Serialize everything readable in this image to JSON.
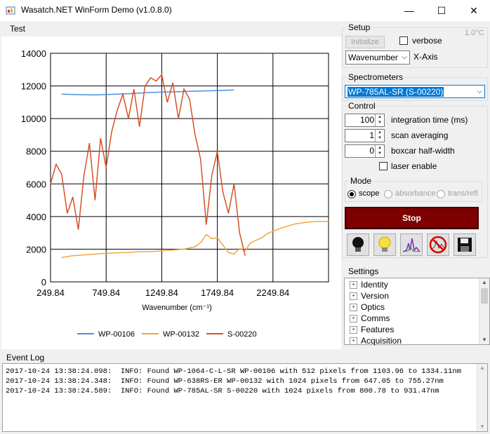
{
  "window": {
    "title": "Wasatch.NET WinForm Demo (v1.0.8.0)",
    "minimize": "—",
    "maximize": "☐",
    "close": "✕"
  },
  "tabs": [
    {
      "label": "Test"
    }
  ],
  "setup": {
    "title": "Setup",
    "initialize_label": "Initialize",
    "verbose_label": "verbose",
    "temperature": "1.0°C",
    "x_axis_value": "Wavenumber",
    "x_axis_label": "X-Axis"
  },
  "spectrometers": {
    "title": "Spectrometers",
    "selected": "WP-785AL-SR (S-00220)"
  },
  "control": {
    "title": "Control",
    "integration_time": {
      "value": "100",
      "label": "integration time (ms)"
    },
    "scan_averaging": {
      "value": "1",
      "label": "scan averaging"
    },
    "boxcar": {
      "value": "0",
      "label": "boxcar half-width"
    },
    "laser_label": "laser enable",
    "mode": {
      "title": "Mode",
      "options": [
        "scope",
        "absorbance",
        "trans/refl"
      ],
      "selected": "scope"
    },
    "stop_label": "Stop"
  },
  "settings": {
    "title": "Settings",
    "items": [
      "Identity",
      "Version",
      "Optics",
      "Comms",
      "Features",
      "Acquisition"
    ]
  },
  "event_log": {
    "title": "Event Log",
    "lines": [
      "2017-10-24 13:38:24.098:  INFO: Found WP-1064-C-L-SR WP-00106 with 512 pixels from 1103.96 to 1334.11nm",
      "2017-10-24 13:38:24.348:  INFO: Found WP-638RS-ER WP-00132 with 1024 pixels from 647.05 to 755.27nm",
      "2017-10-24 13:38:24.589:  INFO: Found WP-785AL-SR S-00220 with 1024 pixels from 800.78 to 931.47nm"
    ]
  },
  "chart_data": {
    "type": "line",
    "xlabel": "Wavenumber (cm⁻¹)",
    "ylabel": "",
    "xlim": [
      249.84,
      2749.84
    ],
    "ylim": [
      0,
      14000
    ],
    "x_ticks": [
      "249.84",
      "749.84",
      "1249.84",
      "1749.84",
      "2249.84"
    ],
    "y_ticks": [
      "0",
      "2000",
      "4000",
      "6000",
      "8000",
      "10000",
      "12000",
      "14000"
    ],
    "grid": true,
    "legend_position": "bottom",
    "series": [
      {
        "name": "WP-00106",
        "color": "#4a8fde",
        "x": [
          349.84,
          449.84,
          549.84,
          649.84,
          749.84,
          849.84,
          949.84,
          1049.84,
          1149.84,
          1249.84,
          1349.84,
          1449.84,
          1549.84,
          1649.84,
          1749.84,
          1849.84,
          1899.84
        ],
        "y": [
          11500,
          11480,
          11460,
          11450,
          11470,
          11500,
          11520,
          11560,
          11600,
          11620,
          11640,
          11660,
          11680,
          11700,
          11720,
          11740,
          11760
        ]
      },
      {
        "name": "WP-00132",
        "color": "#f0a640",
        "x": [
          349.84,
          449.84,
          549.84,
          649.84,
          749.84,
          849.84,
          949.84,
          1049.84,
          1149.84,
          1249.84,
          1349.84,
          1449.84,
          1549.84,
          1599.84,
          1649.84,
          1699.84,
          1749.84,
          1799.84,
          1849.84,
          1899.84,
          1949.84,
          1999.84,
          2049.84,
          2099.84,
          2149.84,
          2199.84,
          2249.84,
          2349.84,
          2449.84,
          2549.84,
          2649.84,
          2749.84
        ],
        "y": [
          1500,
          1600,
          1650,
          1700,
          1750,
          1780,
          1800,
          1850,
          1850,
          1900,
          1950,
          2000,
          2150,
          2400,
          2900,
          2650,
          2700,
          2250,
          1800,
          1700,
          2050,
          1900,
          2400,
          2550,
          2700,
          2950,
          3100,
          3350,
          3550,
          3650,
          3700,
          3700
        ]
      },
      {
        "name": "S-00220",
        "color": "#d65128",
        "x": [
          249.84,
          299.84,
          349.84,
          399.84,
          449.84,
          499.84,
          549.84,
          599.84,
          649.84,
          699.84,
          749.84,
          799.84,
          849.84,
          899.84,
          949.84,
          999.84,
          1049.84,
          1099.84,
          1149.84,
          1199.84,
          1249.84,
          1299.84,
          1349.84,
          1399.84,
          1449.84,
          1499.84,
          1549.84,
          1599.84,
          1649.84,
          1699.84,
          1749.84,
          1799.84,
          1849.84,
          1899.84,
          1949.84,
          1999.84
        ],
        "y": [
          6000,
          7200,
          6600,
          4200,
          5200,
          3200,
          6500,
          8500,
          5000,
          8800,
          7000,
          9200,
          10500,
          11500,
          10000,
          11800,
          9500,
          12000,
          12500,
          12300,
          12700,
          11000,
          12200,
          10000,
          11800,
          11200,
          9000,
          7500,
          3500,
          6500,
          8000,
          5500,
          4200,
          6000,
          3000,
          1600
        ]
      }
    ]
  }
}
